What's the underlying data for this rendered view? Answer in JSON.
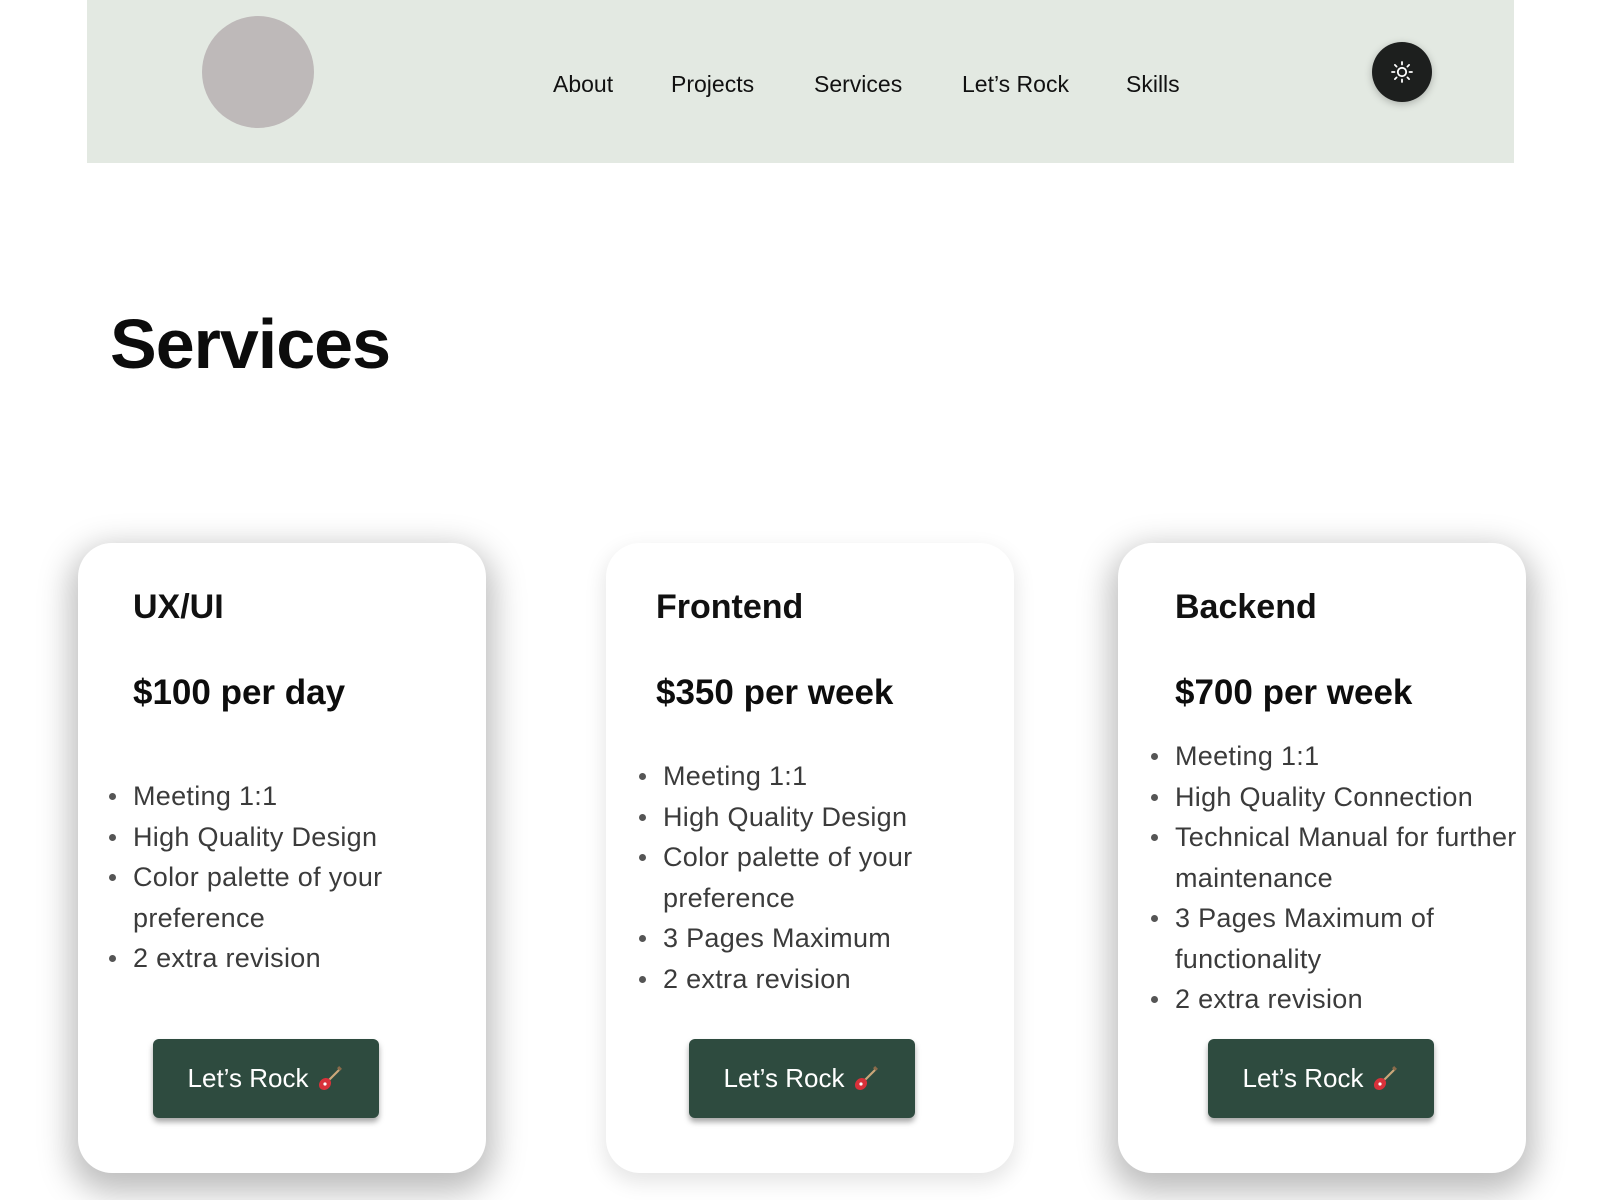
{
  "header": {
    "nav": [
      "About",
      "Projects",
      "Services",
      "Let’s Rock",
      "Skills"
    ],
    "theme_toggle_icon": "sun-icon",
    "background": "#e3e9e2"
  },
  "section": {
    "title": "Services"
  },
  "cards": [
    {
      "title": "UX/UI",
      "price": "$100 per day",
      "features": [
        "Meeting 1:1",
        "High Quality Design",
        "Color palette of your preference",
        "2 extra revision"
      ],
      "button_label": "Let’s Rock",
      "button_icon": "guitar-icon"
    },
    {
      "title": "Frontend",
      "price": "$350 per week",
      "features": [
        "Meeting 1:1",
        "High Quality Design",
        "Color palette of your preference",
        "3 Pages Maximum",
        "2 extra revision"
      ],
      "button_label": "Let’s Rock",
      "button_icon": "guitar-icon"
    },
    {
      "title": "Backend",
      "price": "$700 per week",
      "features": [
        "Meeting 1:1",
        "High Quality Connection",
        "Technical Manual for further maintenance",
        "3 Pages Maximum of functionality",
        "2 extra revision"
      ],
      "button_label": "Let’s Rock",
      "button_icon": "guitar-icon"
    }
  ],
  "colors": {
    "accent_button": "#2e4b3f",
    "toggle": "#1d1f1e",
    "avatar": "#beb9b9"
  }
}
